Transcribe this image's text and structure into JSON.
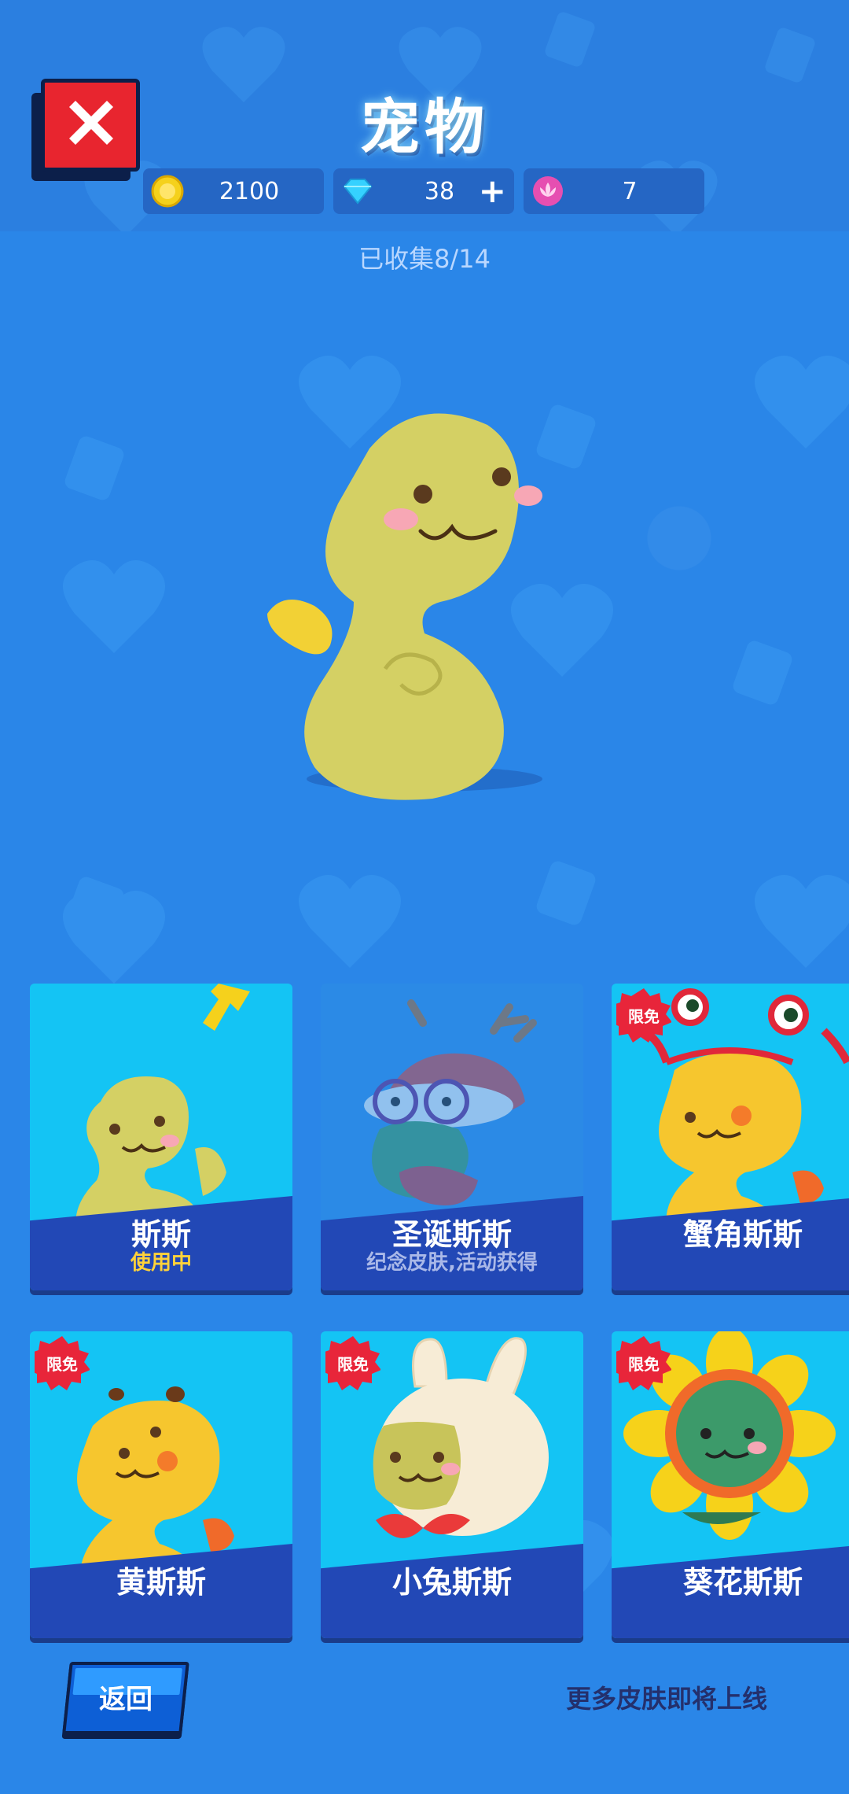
{
  "header": {
    "title": "宠物",
    "close_icon": "close-icon"
  },
  "currencies": [
    {
      "icon": "coin-icon",
      "value": "2100",
      "color": "#f5d11c"
    },
    {
      "icon": "diamond-icon",
      "value": "38",
      "plus": "+",
      "color": "#35d1ff"
    },
    {
      "icon": "lotus-icon",
      "value": "7",
      "color": "#e64fb1"
    }
  ],
  "collected": "已收集8/14",
  "pets": [
    {
      "name": "斯斯",
      "status": "使用中",
      "status_color": "#ffd23a"
    },
    {
      "name": "圣诞斯斯",
      "status": "纪念皮肤,活动获得",
      "status_color": "#a9b8e8"
    },
    {
      "name": "蟹角斯斯",
      "badge": "限免"
    },
    {
      "name": "黄斯斯",
      "badge": "限免"
    },
    {
      "name": "小兔斯斯",
      "badge": "限免"
    },
    {
      "name": "葵花斯斯",
      "badge": "限免"
    }
  ],
  "footer": {
    "back_label": "返回",
    "coming_soon": "更多皮肤即将上线"
  },
  "colors": {
    "background": "#2a86e8",
    "card": "#14c4f4",
    "band": "#2248b6",
    "close": "#e8252f"
  }
}
